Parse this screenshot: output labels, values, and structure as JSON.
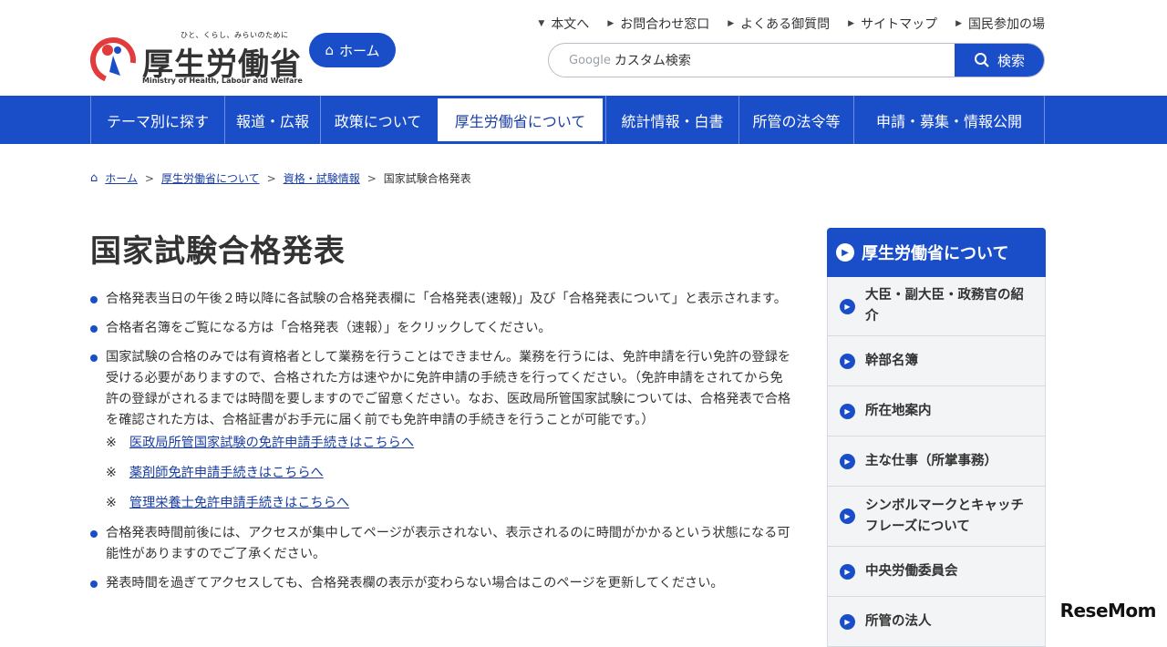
{
  "header": {
    "logo_tagline": "ひと、くらし、みらいのために",
    "logo_name": "厚生労働省",
    "logo_en": "Ministry of Health, Labour and Welfare",
    "home_label": "ホーム",
    "utility_links": [
      "本文へ",
      "お問合わせ窓口",
      "よくある御質問",
      "サイトマップ",
      "国民参加の場"
    ],
    "search_google": "Google",
    "search_placeholder": "カスタム検索",
    "search_button": "検索"
  },
  "nav": {
    "items": [
      "テーマ別に探す",
      "報道・広報",
      "政策について",
      "厚生労働省について",
      "統計情報・白書",
      "所管の法令等",
      "申請・募集・情報公開"
    ],
    "active": "厚生労働省について"
  },
  "breadcrumb": [
    "ホーム",
    "厚生労働省について",
    "資格・試験情報",
    "国家試験合格発表"
  ],
  "main": {
    "title": "国家試験合格発表",
    "bullets": [
      "合格発表当日の午後２時以降に各試験の合格発表欄に「合格発表(速報)」及び「合格発表について」と表示されます。",
      "合格者名簿をご覧になる方は「合格発表（速報）」をクリックしてください。",
      "国家試験の合格のみでは有資格者として業務を行うことはできません。業務を行うには、免許申請を行い免許の登録を受ける必要がありますので、合格された方は速やかに免許申請の手続きを行ってください。（免許申請をされてから免許の登録がされるまでは時間を要しますのでご留意ください。なお、医政局所管国家試験については、合格発表で合格を確認された方は、合格証書がお手元に届く前でも免許申請の手続きを行うことが可能です。）",
      "合格発表時間前後には、アクセスが集中してページが表示されない、表示されるのに時間がかかるという状態になる可能性がありますのでご了承ください。",
      "発表時間を過ぎてアクセスしても、合格発表欄の表示が変わらない場合はこのページを更新してください。"
    ],
    "note_mark": "※",
    "notes": [
      "医政局所管国家試験の免許申請手続きはこちらへ",
      "薬剤師免許申請手続きはこちらへ",
      "管理栄養士免許申請手続きはこちらへ"
    ]
  },
  "sidebar": {
    "heading": "厚生労働省について",
    "items": [
      "大臣・副大臣・政務官の紹介",
      "幹部名簿",
      "所在地案内",
      "主な仕事（所掌事務）",
      "シンボルマークとキャッチフレーズについて",
      "中央労働委員会",
      "所管の法人"
    ]
  },
  "watermark": "ReseMom",
  "colors": {
    "primary": "#1a4ec9",
    "link": "#1a3ea3"
  }
}
